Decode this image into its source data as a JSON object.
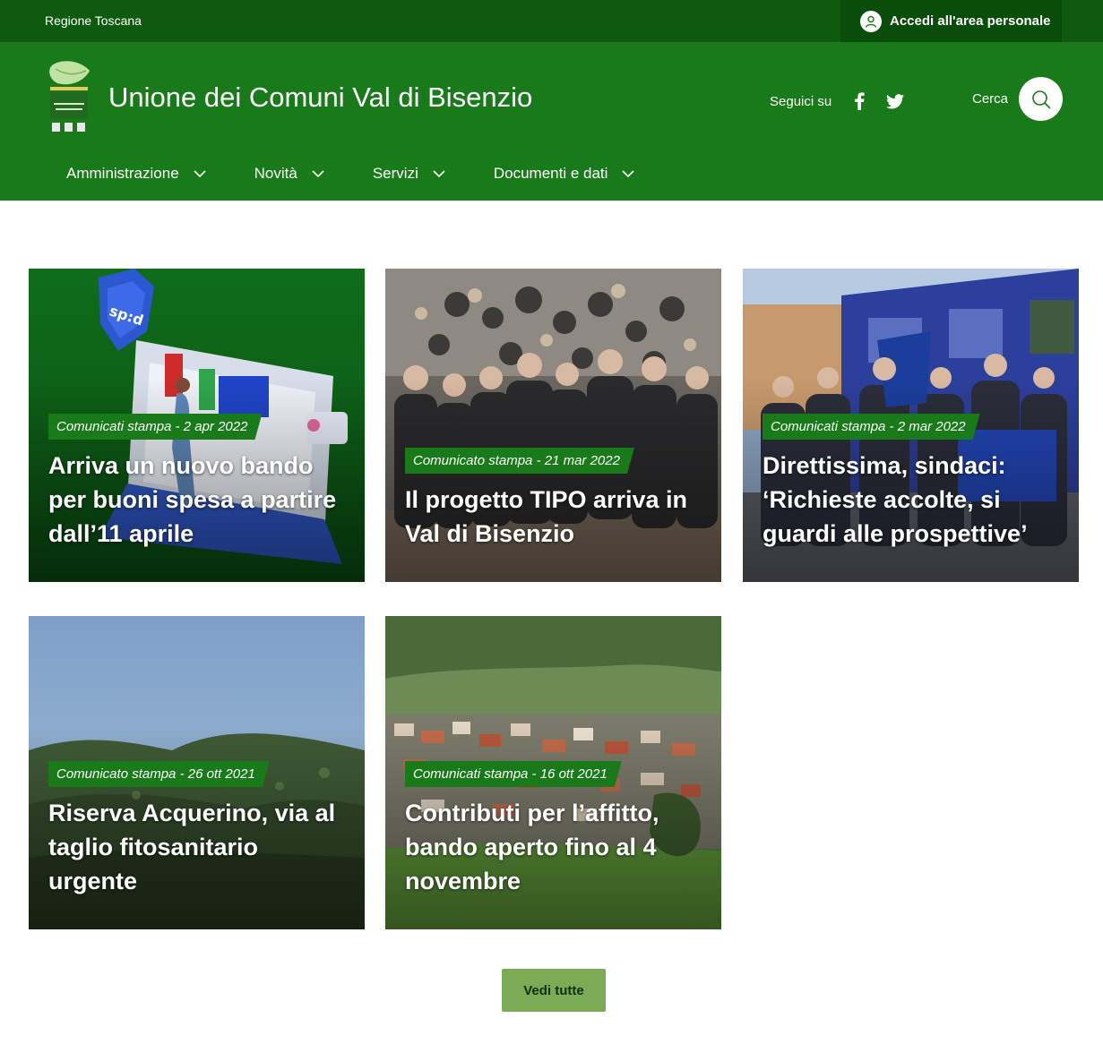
{
  "slim_header": {
    "region": "Regione Toscana",
    "login_label": "Accedi all'area personale"
  },
  "header": {
    "site_title": "Unione dei Comuni Val di Bisenzio",
    "social_label": "Seguici su",
    "search_label": "Cerca"
  },
  "nav": {
    "items": [
      {
        "label": "Amministrazione"
      },
      {
        "label": "Novità"
      },
      {
        "label": "Servizi"
      },
      {
        "label": "Documenti e dati"
      }
    ]
  },
  "news": [
    {
      "category": "Comunicati stampa - 2 apr 2022",
      "title": "Arriva un nuovo bando per buoni spesa a partire dall’11 aprile",
      "image": "spid-laptop-illustration"
    },
    {
      "category": "Comunicato stampa - 21 mar 2022",
      "title": "Il progetto TIPO arriva in Val di Bisenzio",
      "image": "group-photo-textile-warehouse"
    },
    {
      "category": "Comunicati stampa - 2 mar 2022",
      "title": "Direttissima, sindaci: ‘Richieste accolte, si guardi alle prospettive’",
      "image": "mayors-at-train-station"
    },
    {
      "category": "Comunicato stampa - 26 ott 2021",
      "title": "Riserva Acquerino, via al taglio fitosanitario urgente",
      "image": "forested-hills"
    },
    {
      "category": "Comunicati stampa - 16 ott 2021",
      "title": "Contributi per l’affitto, bando aperto fino al 4 novembre",
      "image": "town-in-valley"
    }
  ],
  "see_all_label": "Vedi tutte",
  "colors": {
    "slim_bar": "#0e5a0e",
    "header": "#197a1a",
    "category_tag": "#197a1a",
    "button": "#7cab55"
  }
}
